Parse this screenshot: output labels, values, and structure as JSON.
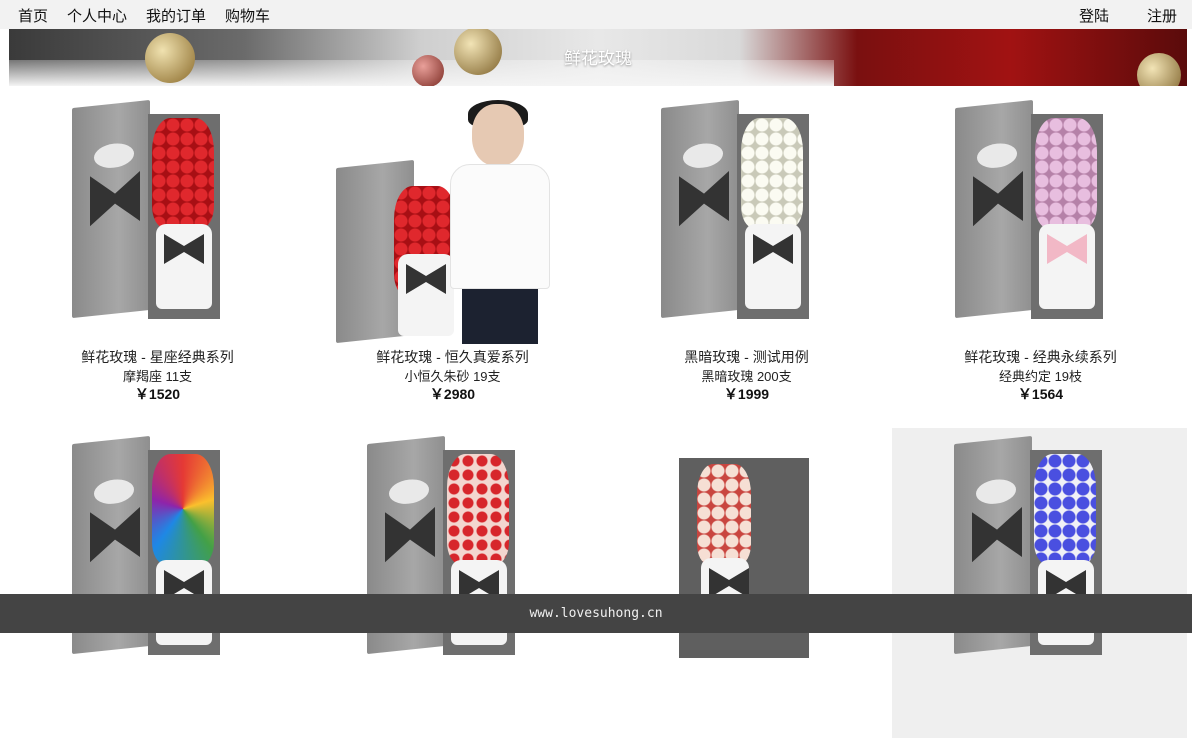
{
  "nav": {
    "left": [
      "首页",
      "个人中心",
      "我的订单",
      "购物车"
    ],
    "right": [
      "登陆",
      "注册"
    ]
  },
  "banner": {
    "title": "鲜花玫瑰"
  },
  "products": [
    {
      "name": "鲜花玫瑰 - 星座经典系列",
      "sub": "摩羯座 11支",
      "price": "￥1520",
      "rose_color": "#c8151b"
    },
    {
      "name": "鲜花玫瑰 - 恒久真爱系列",
      "sub": "小恒久朱砂 19支",
      "price": "￥2980",
      "rose_color": "#c8151b"
    },
    {
      "name": "黑暗玫瑰 - 测试用例",
      "sub": "黑暗玫瑰 200支",
      "price": "￥1999",
      "rose_color": "#f4f3ea"
    },
    {
      "name": "鲜花玫瑰 - 经典永续系列",
      "sub": "经典约定 19枝",
      "price": "￥1564",
      "rose_color": "#d9a6cf"
    },
    {
      "rose_color": "rainbow"
    },
    {
      "rose_color": "mixed"
    },
    {
      "rose_color": "#f0d2c8"
    },
    {
      "rose_color": "#3b3fc4"
    }
  ],
  "footer": {
    "text": "www.lovesuhong.cn"
  }
}
